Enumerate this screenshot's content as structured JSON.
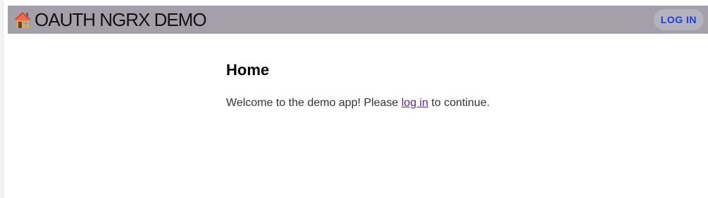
{
  "header": {
    "icon": "house-emoji-icon",
    "title": "OAUTH NGRX DEMO",
    "login_button_label": "LOG IN",
    "background_color": "#a3a0aa",
    "accent_color": "#1f3fd6"
  },
  "main": {
    "title": "Home",
    "welcome_before": "Welcome to the demo app! Please ",
    "welcome_link": "log in",
    "welcome_after": " to continue."
  }
}
